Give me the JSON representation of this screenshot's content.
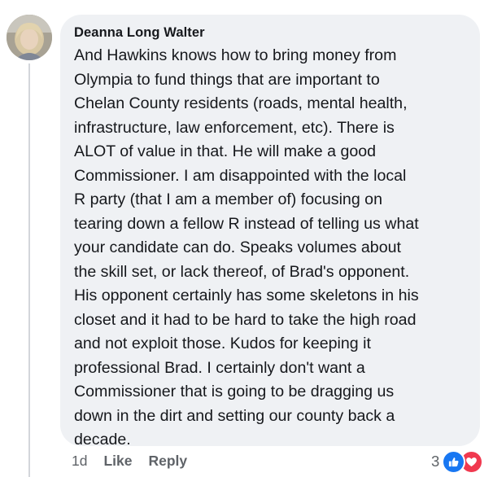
{
  "comment": {
    "author": "Deanna Long Walter",
    "text": "And Hawkins knows how to bring money from\nOlympia to fund things that are important to\nChelan County residents (roads, mental health,\ninfrastructure, law enforcement, etc).  There is\nALOT of value in that.  He will make a good\nCommissioner.  I am disappointed with the local\nR party (that I am a member of) focusing on\ntearing down a fellow R instead of telling us what\nyour candidate can do.  Speaks volumes about\nthe skill set,  or lack thereof,  of Brad's opponent.\nHis opponent certainly has some skeletons in his\ncloset and it had to be hard to take the high road\nand not exploit those.  Kudos for keeping it\nprofessional Brad.  I certainly don't want a\nCommissioner that is going to be dragging us\ndown in the dirt and setting our county back a\ndecade.",
    "avatar_icon": "profile-photo"
  },
  "actions": {
    "time": "1d",
    "like_label": "Like",
    "reply_label": "Reply"
  },
  "reactions": {
    "count": "3",
    "icons": [
      "like-icon",
      "love-icon"
    ],
    "like_color": "#1877f2",
    "love_color": "#f0394f"
  }
}
